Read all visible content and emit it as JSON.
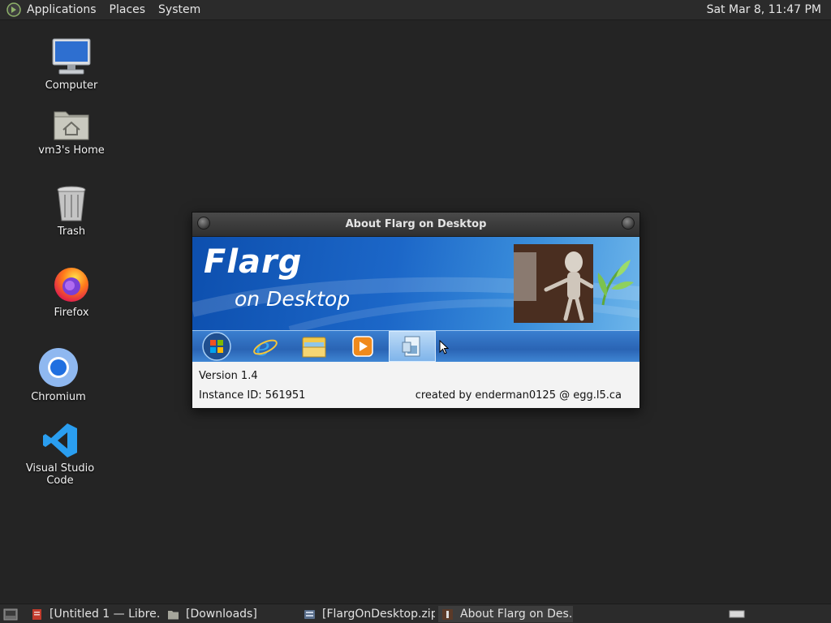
{
  "top_panel": {
    "menus": [
      "Applications",
      "Places",
      "System"
    ],
    "clock": "Sat Mar  8, 11:47 PM"
  },
  "desktop": {
    "icons": [
      {
        "label": "Computer",
        "icon": "computer-icon"
      },
      {
        "label": "vm3's Home",
        "icon": "home-folder-icon"
      },
      {
        "label": "Trash",
        "icon": "trash-icon"
      },
      {
        "label": "Firefox",
        "icon": "firefox-icon"
      },
      {
        "label": "Chromium",
        "icon": "chromium-icon"
      },
      {
        "label": "Visual Studio Code",
        "icon": "vscode-icon"
      }
    ]
  },
  "about_window": {
    "title": "About Flarg on Desktop",
    "banner_title": "Flarg",
    "banner_subtitle": "on Desktop",
    "version": "Version 1.4",
    "instance": "Instance ID:  561951",
    "credit": "created by enderman0125 @ egg.l5.ca"
  },
  "taskbar": {
    "tasks": [
      {
        "label": "[Untitled 1 — Libre…",
        "icon": "document-icon"
      },
      {
        "label": "[Downloads]",
        "icon": "folder-icon"
      },
      {
        "label": "[FlargOnDesktop.zip ]",
        "icon": "archive-icon"
      },
      {
        "label": "About Flarg on Des…",
        "icon": "app-icon"
      }
    ]
  },
  "colors": {
    "desktop_bg": "#242424",
    "panel_bg": "#2b2b2b",
    "banner_blue": "#1c67c8"
  }
}
